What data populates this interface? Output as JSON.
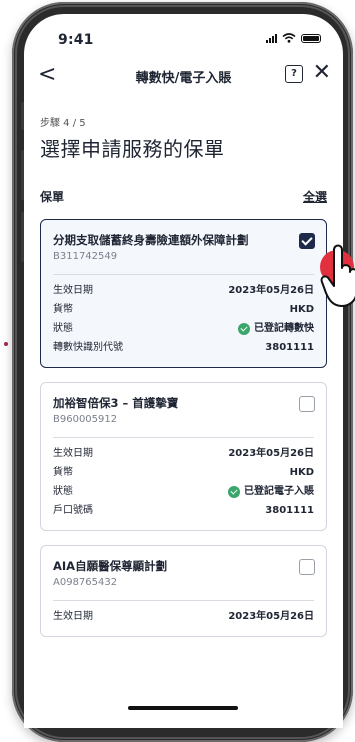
{
  "status_bar": {
    "time": "9:41"
  },
  "nav": {
    "back": "<",
    "title": "轉數快/電子入賬",
    "help": "?",
    "close": "✕"
  },
  "step": "步驟 4 / 5",
  "page_title": "選擇申請服務的保單",
  "section": {
    "title": "保單",
    "select_all": "全選"
  },
  "policies": [
    {
      "name": "分期支取儲蓄終身壽險連額外保障計劃",
      "code": "B311742549",
      "checked": true,
      "rows": [
        {
          "label": "生效日期",
          "value": "2023年05月26日"
        },
        {
          "label": "貨幣",
          "value": "HKD"
        },
        {
          "label": "狀態",
          "value": "已登記轉數快",
          "status": true
        },
        {
          "label": "轉數快識別代號",
          "value": "3801111"
        }
      ]
    },
    {
      "name": "加裕智倍保3 – 首護摯寶",
      "code": "B960005912",
      "checked": false,
      "rows": [
        {
          "label": "生效日期",
          "value": "2023年05月26日"
        },
        {
          "label": "貨幣",
          "value": "HKD"
        },
        {
          "label": "狀態",
          "value": "已登記電子入賬",
          "status": true
        },
        {
          "label": "戶口號碼",
          "value": "3801111"
        }
      ]
    },
    {
      "name": "AIA自願醫保尊顯計劃",
      "code": "A098765432",
      "checked": false,
      "rows": [
        {
          "label": "生效日期",
          "value": "2023年05月26日"
        }
      ]
    }
  ],
  "colors": {
    "accent": "#1e2a4a",
    "success": "#3aa66a",
    "tap": "#e2303f"
  }
}
